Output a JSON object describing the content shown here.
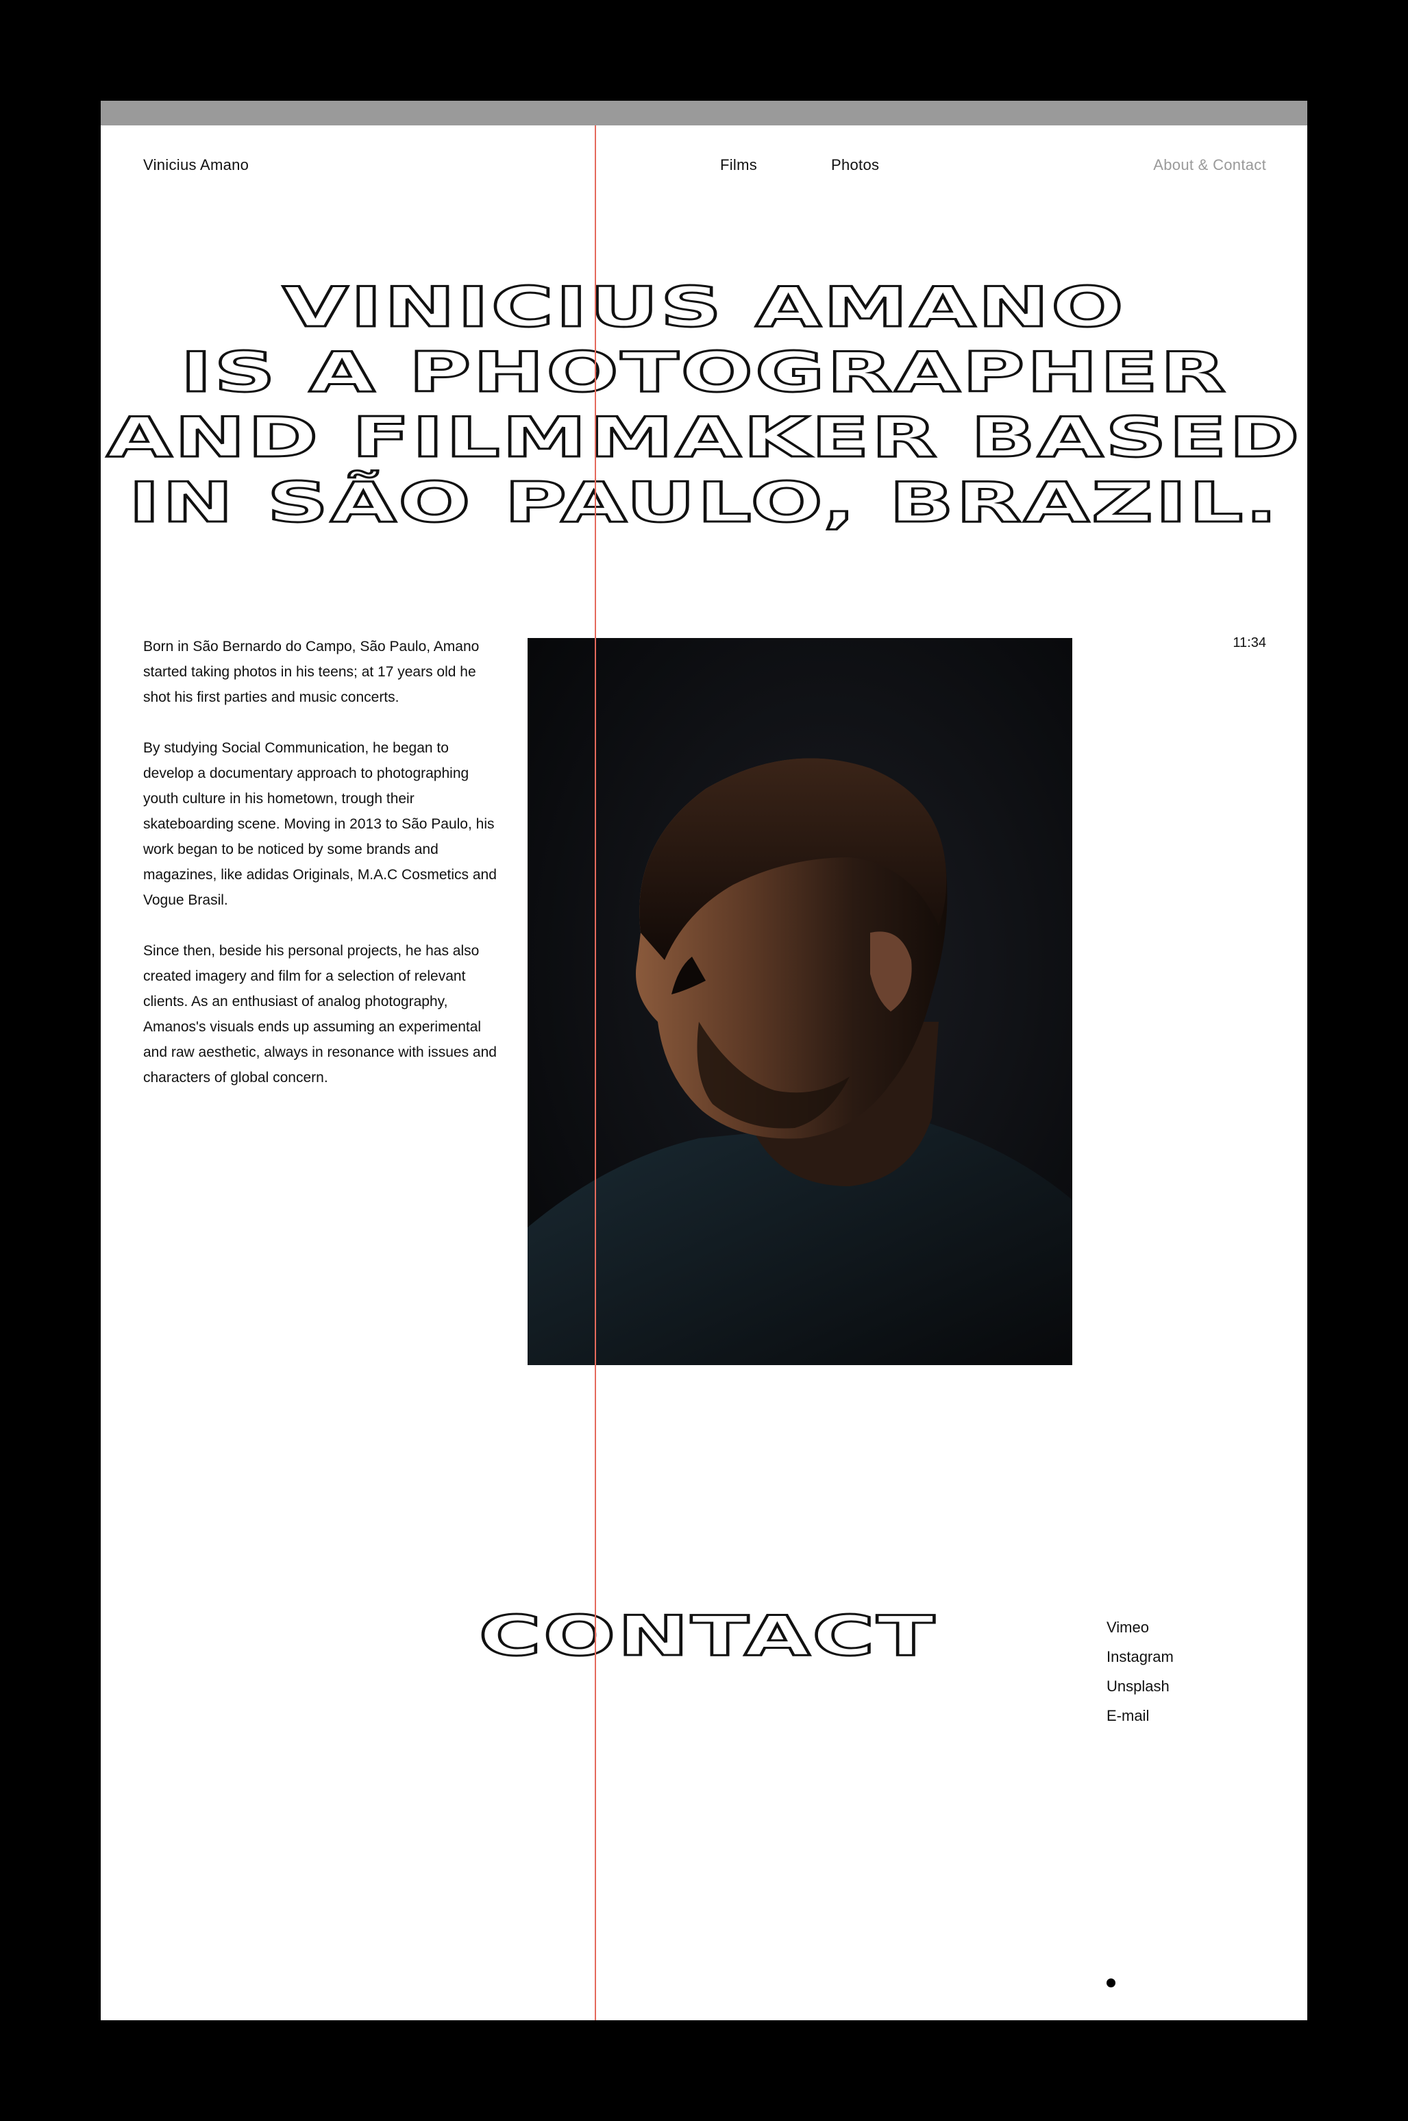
{
  "nav": {
    "brand": "Vinicius Amano",
    "films": "Films",
    "photos": "Photos",
    "about": "About & Contact"
  },
  "headline": {
    "line1": "VINICIUS AMANO",
    "line2": "IS A PHOTOGRAPHER",
    "line3": "AND FILMMAKER BASED",
    "line4": "IN SÃO PAULO, BRAZIL."
  },
  "bio": {
    "p1": "Born in São Bernardo do Campo, São Paulo, Amano started taking photos in his teens; at 17 years old he shot his first parties and music concerts.",
    "p2": "By studying Social Communication, he began to develop a documentary approach to photographing youth culture in his hometown, trough their skateboarding scene. Moving in 2013 to São Paulo, his work began to be noticed by some brands and magazines, like adidas Originals, M.A.C Cosmetics and Vogue Brasil.",
    "p3": "Since then, beside his personal projects, he has also created imagery and film for a selection of relevant clients. As an enthusiast of analog photography, Amanos's visuals ends up assuming an experimental and raw aesthetic, always in resonance with issues and characters of global concern."
  },
  "clock": "11:34",
  "contact": {
    "heading": "CONTACT",
    "links": [
      "Vimeo",
      "Instagram",
      "Unsplash",
      "E-mail"
    ]
  },
  "colors": {
    "accent_line": "#e46a5c",
    "muted_text": "#9a9a9a",
    "window_bar": "#9a9a9a"
  }
}
